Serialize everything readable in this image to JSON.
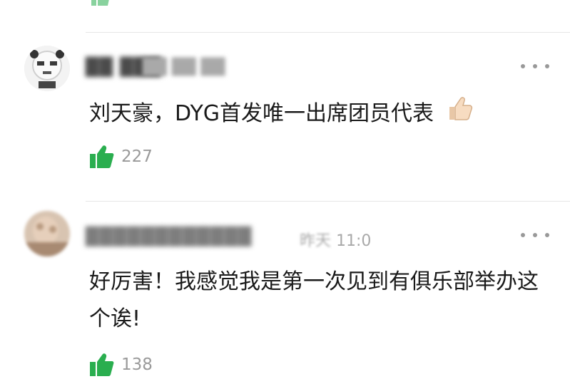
{
  "colors": {
    "like_green": "#2aae4f",
    "divider": "#e6e6e6",
    "meta_gray": "#a9a9a9"
  },
  "comments": [
    {
      "author": "██ ███",
      "time": "██ ██ ██",
      "text": "刘天豪，DYG首发唯一出席团员代表",
      "emoji": "thumbs-up",
      "likes": "227"
    },
    {
      "author": "████████████",
      "time_prefix": "昨天",
      "time": "11:0",
      "text": "好厉害！我感觉我是第一次见到有俱乐部举办这个诶!",
      "likes": "138"
    }
  ],
  "icons": [
    "like-icon",
    "more-icon",
    "thumbs-up-emoji-icon"
  ]
}
